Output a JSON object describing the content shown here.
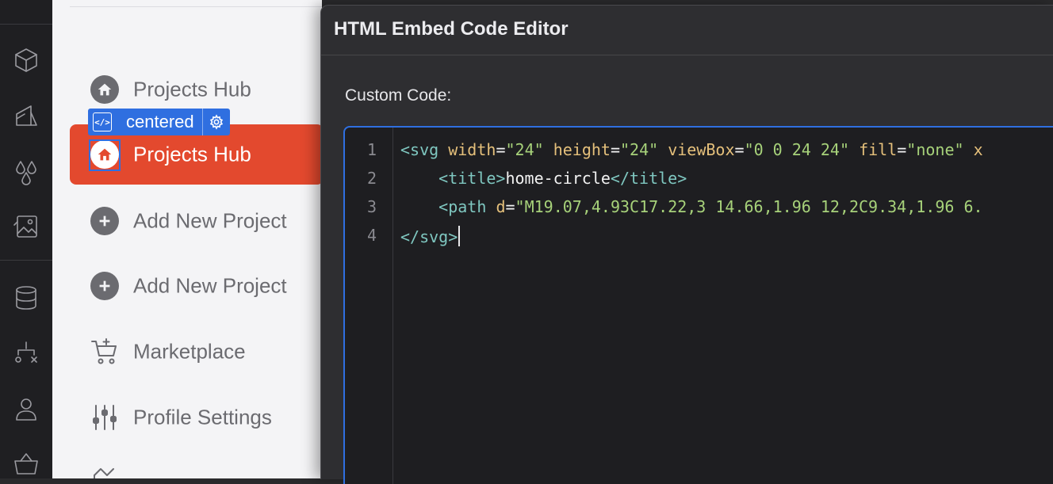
{
  "modal": {
    "title": "HTML Embed Code Editor",
    "custom_code_label": "Custom Code:"
  },
  "badge": {
    "element_name": "centered",
    "code_icon_glyph": "</>"
  },
  "nav": {
    "items": [
      {
        "label": "Projects Hub",
        "icon": "home-circle-icon",
        "active": false
      },
      {
        "label": "Projects Hub",
        "icon": "home-circle-icon",
        "active": true
      },
      {
        "label": "Add New Project",
        "icon": "plus-circle-icon",
        "active": false
      },
      {
        "label": "Add New Project",
        "icon": "plus-circle-icon",
        "active": false
      },
      {
        "label": "Marketplace",
        "icon": "cart-plus-icon",
        "active": false
      },
      {
        "label": "Profile Settings",
        "icon": "sliders-icon",
        "active": false
      }
    ]
  },
  "rail": {
    "icons": [
      "cube-icon",
      "paint-bucket-icon",
      "droplets-icon",
      "image-icon",
      "database-icon",
      "workflow-icon",
      "user-icon",
      "basket-icon"
    ]
  },
  "editor": {
    "line_numbers": [
      "1",
      "2",
      "3",
      "4"
    ],
    "line1": {
      "open": "<svg",
      "attr_width": "width",
      "eq1": "=",
      "val_width": "\"24\"",
      "attr_height": "height",
      "eq2": "=",
      "val_height": "\"24\"",
      "attr_viewbox": "viewBox",
      "eq3": "=",
      "val_viewbox": "\"0 0 24 24\"",
      "attr_fill": "fill",
      "eq4": "=",
      "val_fill": "\"none\"",
      "tail": "x"
    },
    "line2": {
      "open_tag": "<title>",
      "text": "home-circle",
      "close_tag": "</title>"
    },
    "line3": {
      "open": "<path",
      "attr_d": "d",
      "eq": "=",
      "val_d": "\"M19.07,4.93C17.22,3 14.66,1.96 12,2C9.34,1.96 6."
    },
    "line4": {
      "close": "</svg>"
    }
  },
  "colors": {
    "accent_active": "#e3492e",
    "selection_blue": "#2f6fe0",
    "editor_bg": "#1e1e21"
  }
}
